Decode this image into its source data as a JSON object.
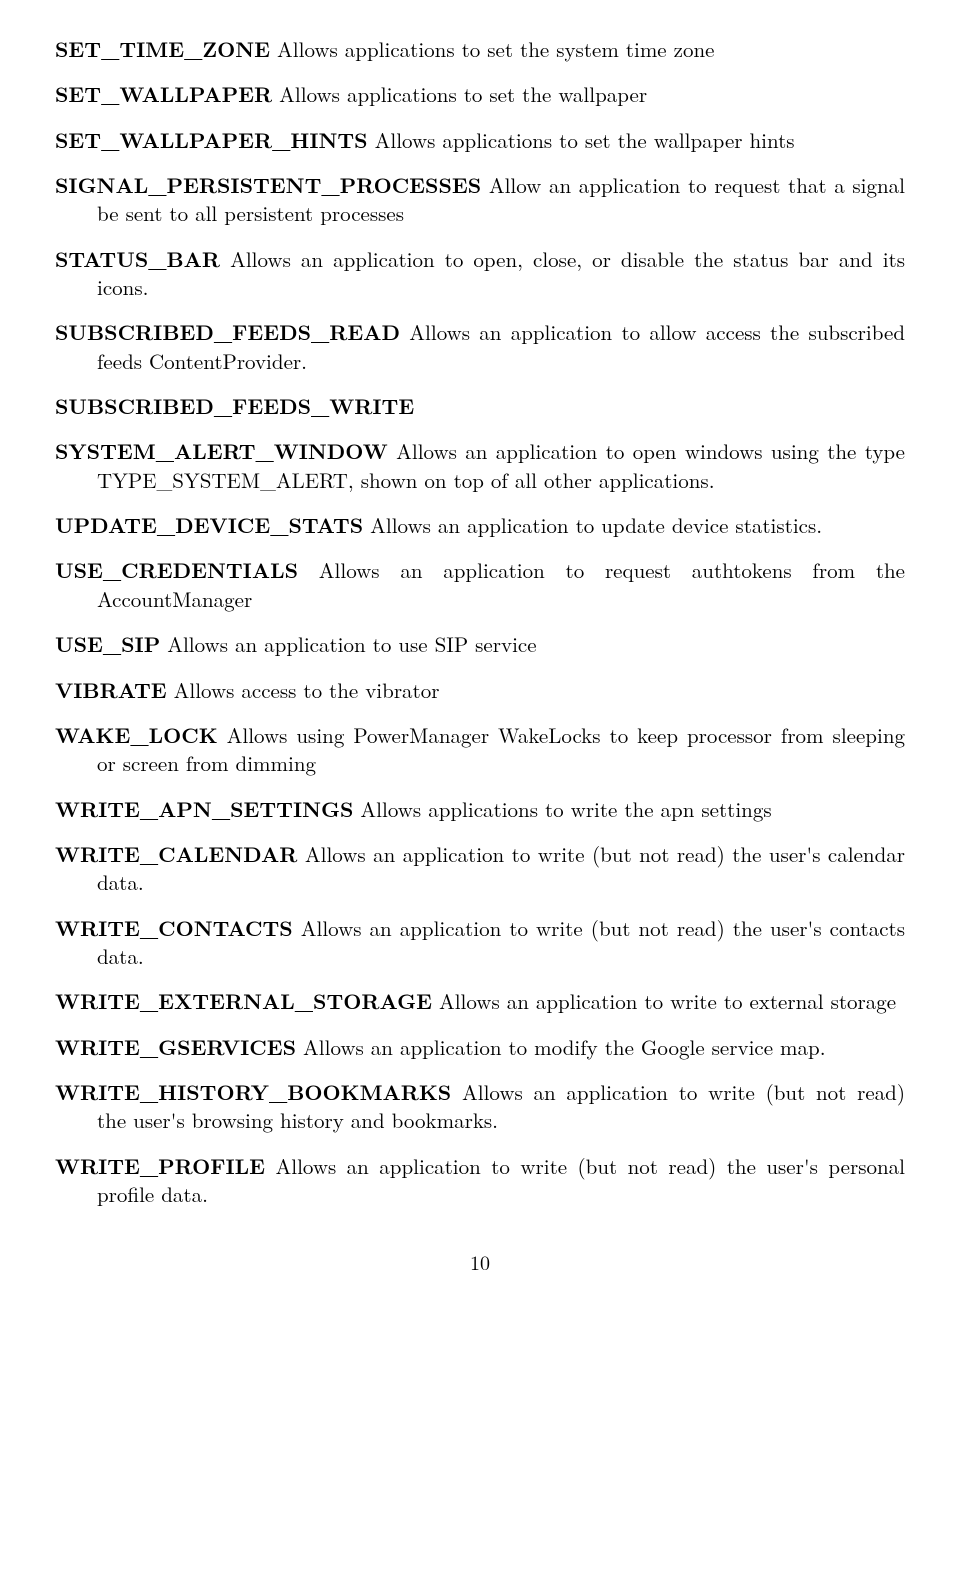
{
  "entries": [
    {
      "term": "SET_TIME_ZONE",
      "desc": " Allows applications to set the system time zone"
    },
    {
      "term": "SET_WALLPAPER",
      "desc": " Allows applications to set the wallpaper"
    },
    {
      "term": "SET_WALLPAPER_HINTS",
      "desc": " Allows applications to set the wallpaper hints"
    },
    {
      "term": "SIGNAL_PERSISTENT_PROCESSES",
      "desc": " Allow an application to request that a signal be sent to all persistent processes"
    },
    {
      "term": "STATUS_BAR",
      "desc": " Allows an application to open, close, or disable the status bar and its icons."
    },
    {
      "term": "SUBSCRIBED_FEEDS_READ",
      "desc": " Allows an application to allow access the subscribed feeds ContentProvider."
    },
    {
      "term": "SUBSCRIBED_FEEDS_WRITE",
      "desc": ""
    },
    {
      "term": "SYSTEM_ALERT_WINDOW",
      "desc": " Allows an application to open windows using the type TYPE_SYSTEM_ALERT, shown on top of all other applications."
    },
    {
      "term": "UPDATE_DEVICE_STATS",
      "desc": " Allows an application to update device statistics."
    },
    {
      "term": "USE_CREDENTIALS",
      "desc": " Allows an application to request authtokens from the AccountManager"
    },
    {
      "term": "USE_SIP",
      "desc": " Allows an application to use SIP service"
    },
    {
      "term": "VIBRATE",
      "desc": " Allows access to the vibrator"
    },
    {
      "term": "WAKE_LOCK",
      "desc": " Allows using PowerManager WakeLocks to keep processor from sleeping or screen from dimming"
    },
    {
      "term": "WRITE_APN_SETTINGS",
      "desc": " Allows applications to write the apn settings"
    },
    {
      "term": "WRITE_CALENDAR",
      "desc": " Allows an application to write (but not read) the user's calendar data."
    },
    {
      "term": "WRITE_CONTACTS",
      "desc": " Allows an application to write (but not read) the user's contacts data."
    },
    {
      "term": "WRITE_EXTERNAL_STORAGE",
      "desc": " Allows an application to write to external storage"
    },
    {
      "term": "WRITE_GSERVICES",
      "desc": " Allows an application to modify the Google service map."
    },
    {
      "term": "WRITE_HISTORY_BOOKMARKS",
      "desc": " Allows an application to write (but not read) the user's browsing history and bookmarks."
    },
    {
      "term": "WRITE_PROFILE",
      "desc": " Allows an application to write (but not read) the user's personal profile data."
    }
  ],
  "page_number": "10"
}
